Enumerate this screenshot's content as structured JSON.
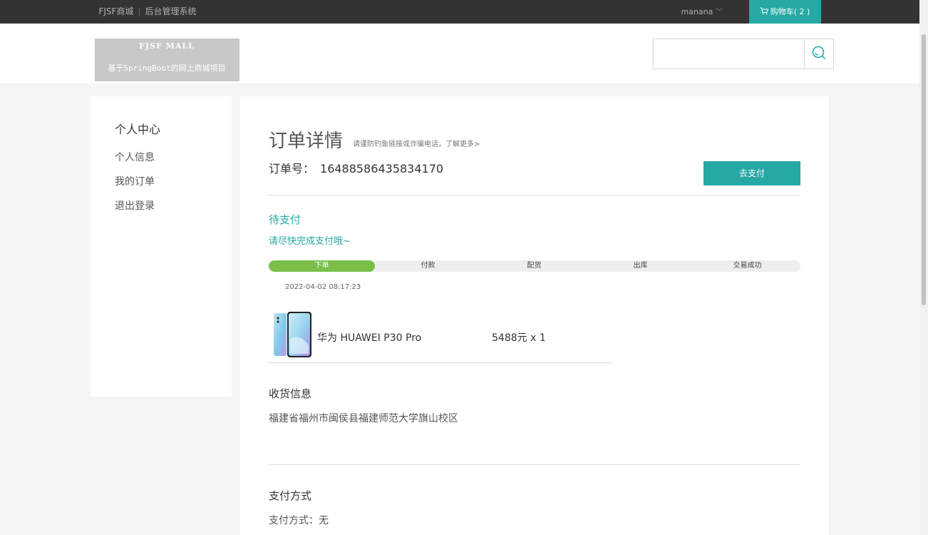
{
  "topbar": {
    "brand": "FJSF商城",
    "separator": "|",
    "admin_link": "后台管理系统",
    "username": "manana",
    "cart_label": "购物车( 2 )"
  },
  "header": {
    "logo_line1": "FJSF MALL",
    "logo_line2": "基于SpringBoot的网上商城项目",
    "search_placeholder": ""
  },
  "sidebar": {
    "title": "个人中心",
    "items": [
      {
        "label": "个人信息"
      },
      {
        "label": "我的订单"
      },
      {
        "label": "退出登录"
      }
    ]
  },
  "order": {
    "page_title": "订单详情",
    "tip": "请谨防钓鱼链接或诈骗电话，了解更多>",
    "order_no_label": "订单号：",
    "order_no": "16488586435834170",
    "pay_button": "去支付",
    "status": "待支付",
    "status_desc": "请尽快完成支付哦~",
    "progress": {
      "steps": [
        "下单",
        "付款",
        "配货",
        "出库",
        "交易成功"
      ],
      "completed_steps": 1
    },
    "timestamp": "2022-04-02 08:17:23",
    "items": [
      {
        "name": "华为 HUAWEI P30 Pro",
        "price_qty": "5488元 x 1"
      }
    ],
    "shipping_title": "收货信息",
    "shipping_address": "福建省福州市闽侯县福建师范大学旗山校区",
    "payment_title": "支付方式",
    "payment_method": "支付方式：无"
  },
  "colors": {
    "accent": "#26a9a5",
    "progress_done": "#79bf4a",
    "topbar_bg": "#333333"
  }
}
